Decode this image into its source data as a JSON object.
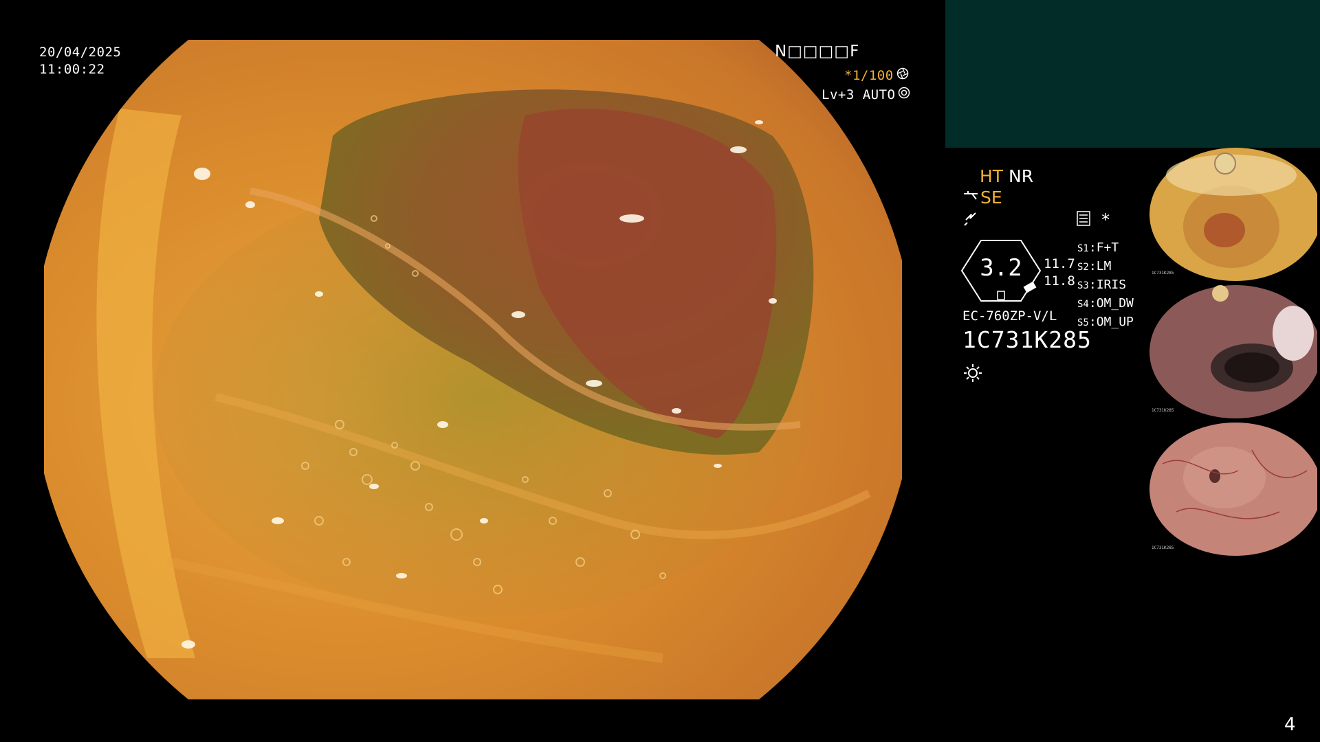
{
  "datetime": {
    "date": "20/04/2025",
    "time": "11:00:22"
  },
  "top_right": {
    "id_code": "N□□□□F",
    "shutter": "*1/100",
    "level": "Lv+3 AUTO"
  },
  "panel": {
    "ht": "HT",
    "nr": "NR",
    "se": "SE",
    "asterisk": "*",
    "gauge_value": "3.2",
    "reading_1": "11.7",
    "reading_2": "11.8",
    "scope_model": "EC-760ZP-V/L",
    "serial": "1C731K285",
    "presets": [
      {
        "key": "S1",
        "value": "F+T"
      },
      {
        "key": "S2",
        "value": "LM"
      },
      {
        "key": "S3",
        "value": "IRIS"
      },
      {
        "key": "S4",
        "value": "OM_DW"
      },
      {
        "key": "S5",
        "value": "OM_UP"
      }
    ]
  },
  "thumbnails_serial": "1C731K285",
  "page_number": "4",
  "icons": [
    "aperture-icon",
    "auto-mode-icon",
    "scope-tip-icon",
    "lightning-icon",
    "image-settings-icon",
    "light-icon"
  ],
  "colors": {
    "teal_box": "#022c28",
    "amber": "#f2b233",
    "background": "#000000"
  }
}
